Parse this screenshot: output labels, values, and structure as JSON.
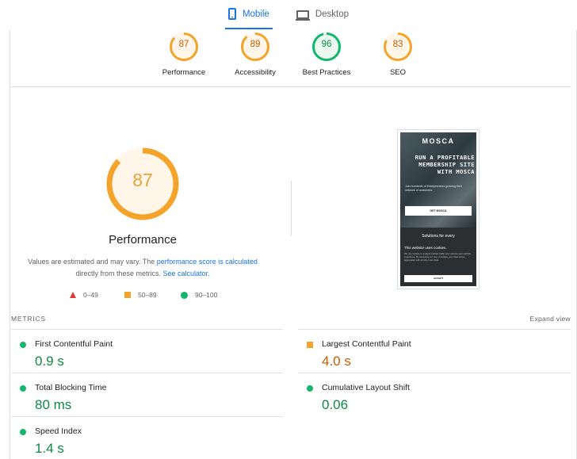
{
  "tabs": [
    {
      "label": "Mobile",
      "active": true,
      "icon": "phone-icon"
    },
    {
      "label": "Desktop",
      "active": false,
      "icon": "laptop-icon"
    }
  ],
  "summary": [
    {
      "label": "Performance",
      "score": "87",
      "color": "#f4a42b",
      "text_color": "#c85b00",
      "fill": "#fff6e9",
      "fraction": 0.87
    },
    {
      "label": "Accessibility",
      "score": "89",
      "color": "#f4a42b",
      "text_color": "#c85b00",
      "fill": "#fff6e9",
      "fraction": 0.89
    },
    {
      "label": "Best Practices",
      "score": "96",
      "color": "#12b76a",
      "text_color": "#0c8a45",
      "fill": "#eafaf1",
      "fraction": 0.96
    },
    {
      "label": "SEO",
      "score": "83",
      "color": "#f4a42b",
      "text_color": "#c85b00",
      "fill": "#fff6e9",
      "fraction": 0.83
    }
  ],
  "performance": {
    "score": "87",
    "fraction": 0.87,
    "title": "Performance",
    "note_prefix": "Values are estimated and may vary. The ",
    "note_link1": "performance score is calculated",
    "note_mid": " directly from these metrics. ",
    "note_link2": "See calculator.",
    "legend": [
      {
        "shape": "triangle",
        "range": "0–49",
        "color": "#e53935"
      },
      {
        "shape": "square",
        "range": "50–89",
        "color": "#f4a42b"
      },
      {
        "shape": "circle",
        "range": "90–100",
        "color": "#12b76a"
      }
    ]
  },
  "screenshot": {
    "logo": "MOSCA",
    "headline": "RUN A PROFITABLE MEMBERSHIP SITE WITH MOSCA",
    "subtext": "Join hundreds of Entrepreneurs growing their network of customers.",
    "cta": "GET MOSCA",
    "section": "Solutions for every",
    "cookie_title": "This website uses cookies.",
    "cookie_text": "We use cookies to analyze website traffic and optimize your website experience. By accepting our use of cookies, your data will be aggregated with all other user data.",
    "accept": "ACCEPT"
  },
  "metrics": {
    "title": "METRICS",
    "expand": "Expand view",
    "items": [
      {
        "name": "First Contentful Paint",
        "value": "0.9 s",
        "status": "good"
      },
      {
        "name": "Largest Contentful Paint",
        "value": "4.0 s",
        "status": "average"
      },
      {
        "name": "Total Blocking Time",
        "value": "80 ms",
        "status": "good"
      },
      {
        "name": "Cumulative Layout Shift",
        "value": "0.06",
        "status": "good"
      },
      {
        "name": "Speed Index",
        "value": "1.4 s",
        "status": "good"
      }
    ]
  }
}
